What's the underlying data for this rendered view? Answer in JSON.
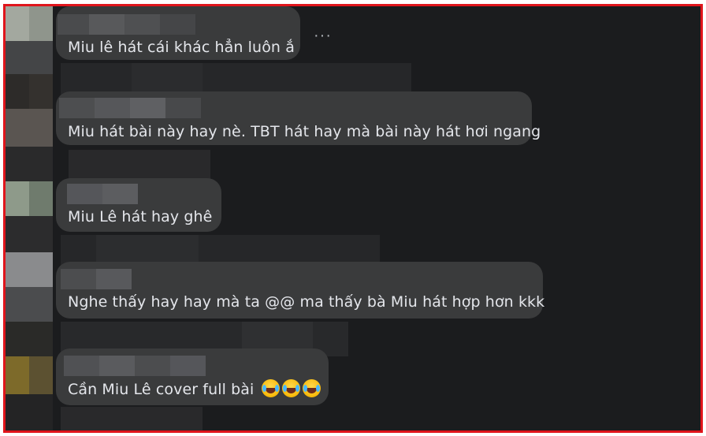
{
  "comments": [
    {
      "text": "Miu lê hát cái khác hẳn luôn ắ"
    },
    {
      "text": "Miu hát bài này hay nè. TBT hát hay mà bài này hát hơi ngang"
    },
    {
      "text": "Miu Lê hát hay ghê"
    },
    {
      "text": "Nghe thấy hay hay mà ta @@ ma thấy bà Miu hát hợp hơn kkk"
    },
    {
      "text": "Cần Miu Lê cover full bài",
      "emojis": [
        "rolling-laughing-emoji",
        "rolling-laughing-emoji",
        "rolling-laughing-emoji"
      ]
    }
  ],
  "more_label": "···",
  "colors": {
    "background": "#1b1c1e",
    "bubble": "#3a3b3c",
    "text": "#e4e6eb",
    "border": "#e0141b"
  }
}
